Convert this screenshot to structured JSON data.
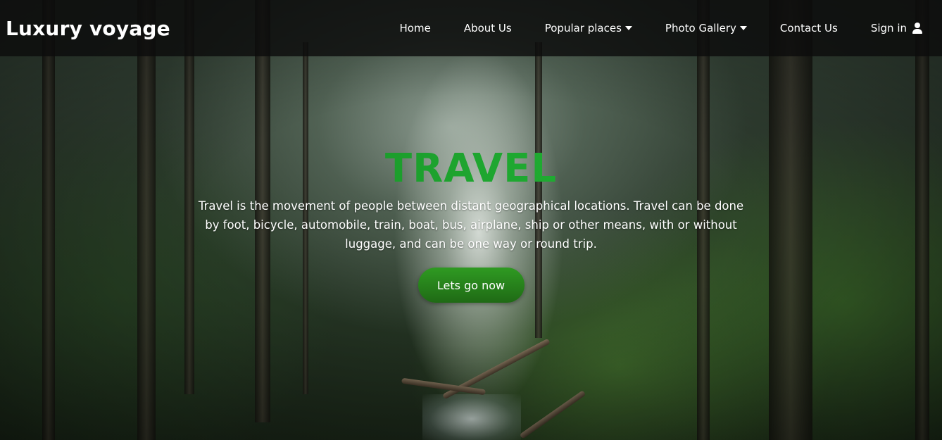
{
  "navbar": {
    "brand": "Luxury voyage",
    "items": [
      {
        "label": "Home"
      },
      {
        "label": "About Us"
      },
      {
        "label": "Popular places"
      },
      {
        "label": "Photo Gallery"
      },
      {
        "label": "Contact Us"
      },
      {
        "label": "Sign in"
      }
    ],
    "icons": {
      "dropdown": "caret-down-icon",
      "sign_in": "user-icon"
    }
  },
  "hero": {
    "title": "TRAVEL",
    "text": "Travel is the movement of people between distant geographical locations. Travel can be done by foot, bicycle, automobile, train, boat, bus, airplane, ship or other means, with or without luggage, and can be one way or round trip.",
    "cta_label": "Lets go now"
  },
  "colors": {
    "title_green": "#1ea52f",
    "button_green": "#2a8a1e",
    "navbar_bg": "#0c0c0c"
  }
}
